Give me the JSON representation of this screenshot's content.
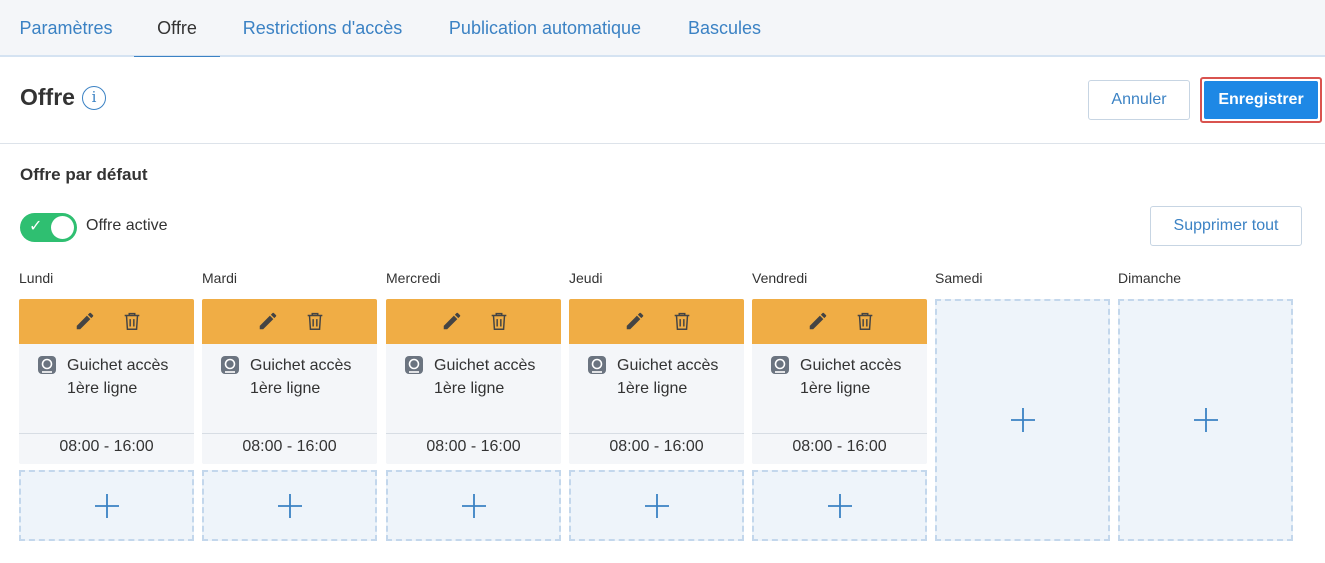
{
  "tabs": [
    {
      "label": "Paramètres"
    },
    {
      "label": "Offre"
    },
    {
      "label": "Restrictions d'accès"
    },
    {
      "label": "Publication automatique"
    },
    {
      "label": "Bascules"
    }
  ],
  "header": {
    "title": "Offre",
    "info_icon": "info-circle-icon",
    "cancel_label": "Annuler",
    "save_label": "Enregistrer"
  },
  "section": {
    "title": "Offre par défaut",
    "toggle_label": "Offre active",
    "toggle_on": true,
    "delete_all_label": "Supprimer tout"
  },
  "days": [
    {
      "label": "Lundi",
      "slot": {
        "service_line1": "Guichet accès",
        "service_line2": "1ère ligne",
        "time": "08:00 - 16:00"
      }
    },
    {
      "label": "Mardi",
      "slot": {
        "service_line1": "Guichet accès",
        "service_line2": "1ère ligne",
        "time": "08:00 - 16:00"
      }
    },
    {
      "label": "Mercredi",
      "slot": {
        "service_line1": "Guichet accès",
        "service_line2": "1ère ligne",
        "time": "08:00 - 16:00"
      }
    },
    {
      "label": "Jeudi",
      "slot": {
        "service_line1": "Guichet accès",
        "service_line2": "1ère ligne",
        "time": "08:00 - 16:00"
      }
    },
    {
      "label": "Vendredi",
      "slot": {
        "service_line1": "Guichet accès",
        "service_line2": "1ère ligne",
        "time": "08:00 - 16:00"
      }
    },
    {
      "label": "Samedi",
      "slot": null
    },
    {
      "label": "Dimanche",
      "slot": null
    }
  ],
  "colors": {
    "accent": "#3b82c4",
    "primary_button": "#1e88e5",
    "slot_header": "#f0ad45",
    "toggle_on": "#2fbf71",
    "highlight_border": "#d9534f"
  },
  "icons": {
    "edit": "pencil-icon",
    "delete": "trash-icon",
    "service": "service-desk-icon",
    "add": "plus-icon"
  }
}
